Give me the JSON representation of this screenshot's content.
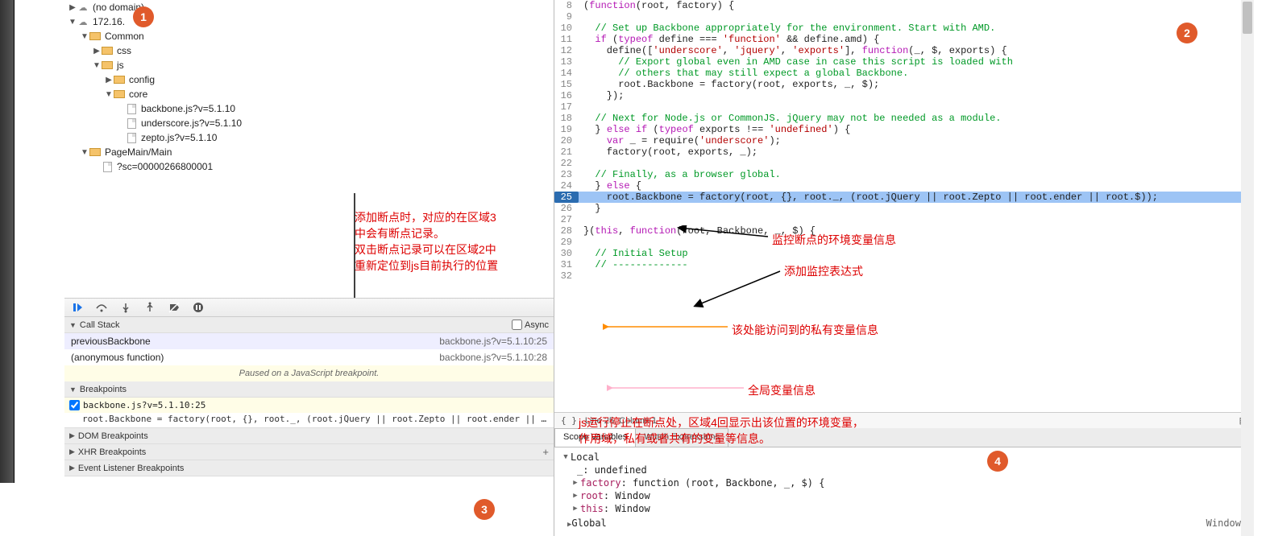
{
  "tree": {
    "nodomain": "(no domain)",
    "host": "172.16.          ",
    "common": "Common",
    "css": "css",
    "js": "js",
    "config": "config",
    "core": "core",
    "f_backbone": "backbone.js?v=5.1.10",
    "f_underscore": "underscore.js?v=5.1.10",
    "f_zepto": "zepto.js?v=5.1.10",
    "pagemain": "PageMain/Main",
    "scfile": "?sc=00000266800001"
  },
  "annot": {
    "a1": "添加断点时，对应的在区域3\n中会有断点记录。\n双击断点记录可以在区域2中\n重新定位到js目前执行的位置",
    "env": "监控断点的环境变量信息",
    "watch": "添加监控表达式",
    "local": "该处能访问到的私有变量信息",
    "global": "全局变量信息",
    "bottom": "js运行停止在断点处，区域4回显示出该位置的环境变量，\n作用域，私有或者共有的变量等信息。"
  },
  "badges": {
    "b1": "1",
    "b2": "2",
    "b3": "3",
    "b4": "4"
  },
  "debugPanels": {
    "callstack_hdr": "Call Stack",
    "async": "Async",
    "cs1_name": "previousBackbone",
    "cs1_loc": "backbone.js?v=5.1.10:25",
    "cs2_name": "(anonymous function)",
    "cs2_loc": "backbone.js?v=5.1.10:28",
    "pause_msg": "Paused on a JavaScript breakpoint.",
    "bp_hdr": "Breakpoints",
    "bp1_label": "backbone.js?v=5.1.10:25",
    "bp1_code": "root.Backbone = factory(root, {}, root._, (root.jQuery || root.Zepto || root.ender || roo…",
    "dom_bp": "DOM Breakpoints",
    "xhr_bp": "XHR Breakpoints",
    "evt_bp": "Event Listener Breakpoints"
  },
  "editorLines": [
    {
      "n": 8,
      "html": "(<span class='kw'>function</span>(root, factory) {"
    },
    {
      "n": 9,
      "html": ""
    },
    {
      "n": 10,
      "html": "  <span class='com'>// Set up Backbone appropriately for the environment. Start with AMD.</span>"
    },
    {
      "n": 11,
      "html": "  <span class='kw'>if</span> (<span class='kw'>typeof</span> define === <span class='str'>'function'</span> && define.amd) {"
    },
    {
      "n": 12,
      "html": "    define([<span class='str'>'underscore'</span>, <span class='str'>'jquery'</span>, <span class='str'>'exports'</span>], <span class='kw'>function</span>(_, $, exports) {"
    },
    {
      "n": 13,
      "html": "      <span class='com'>// Export global even in AMD case in case this script is loaded with</span>"
    },
    {
      "n": 14,
      "html": "      <span class='com'>// others that may still expect a global Backbone.</span>"
    },
    {
      "n": 15,
      "html": "      root.Backbone = factory(root, exports, _, $);"
    },
    {
      "n": 16,
      "html": "    });"
    },
    {
      "n": 17,
      "html": ""
    },
    {
      "n": 18,
      "html": "  <span class='com'>// Next for Node.js or CommonJS. jQuery may not be needed as a module.</span>"
    },
    {
      "n": 19,
      "html": "  } <span class='kw'>else if</span> (<span class='kw'>typeof</span> exports !== <span class='str'>'undefined'</span>) {"
    },
    {
      "n": 20,
      "html": "    <span class='kw'>var</span> _ = require(<span class='str'>'underscore'</span>);"
    },
    {
      "n": 21,
      "html": "    factory(root, exports, _);"
    },
    {
      "n": 22,
      "html": ""
    },
    {
      "n": 23,
      "html": "  <span class='com'>// Finally, as a browser global.</span>"
    },
    {
      "n": 24,
      "html": "  } <span class='kw'>else</span> {"
    },
    {
      "n": 25,
      "hl": true,
      "html": "    root.Backbone = factory(root, {}, root._, (root.jQuery || root.Zepto || root.ender || root.$));"
    },
    {
      "n": 26,
      "html": "  }"
    },
    {
      "n": 27,
      "html": ""
    },
    {
      "n": 28,
      "html": "}(<span class='kw'>this</span>, <span class='kw'>function</span>(root, Backbone, _, $) {"
    },
    {
      "n": 29,
      "html": ""
    },
    {
      "n": 30,
      "html": "  <span class='com'>// Initial Setup</span>"
    },
    {
      "n": 31,
      "html": "  <span class='com'>// -------------</span>"
    },
    {
      "n": 32,
      "html": ""
    }
  ],
  "status": {
    "pos": "Line 25, Column 1"
  },
  "scopeTabs": {
    "sv": "Scope Variables",
    "we": "Watch Expressions"
  },
  "scope": {
    "local": "Local",
    "underscore": "_: undefined",
    "factory_k": "factory",
    "factory_v": ": function (root, Backbone, _, $) {",
    "root_k": "root",
    "root_v": ": Window",
    "this_k": "this",
    "this_v": ": Window",
    "global": "Global",
    "global_v": "Window"
  }
}
